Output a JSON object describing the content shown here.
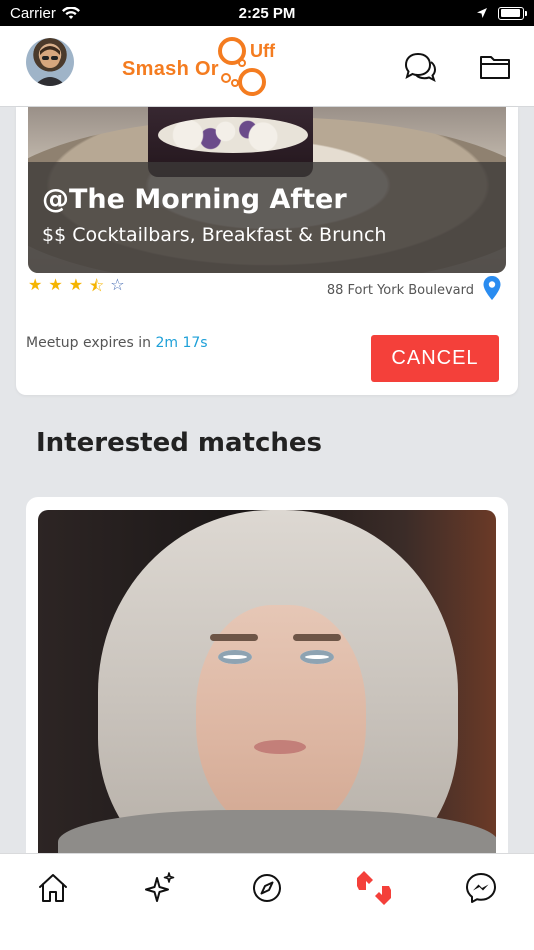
{
  "status_bar": {
    "carrier": "Carrier",
    "time": "2:25 PM",
    "battery_level": 0.9
  },
  "header": {
    "logo": {
      "text": "Smash Or",
      "suffix": "Uff",
      "brand_color": "#f47c20"
    },
    "icons": [
      "avatar",
      "chat-bubbles-icon",
      "folder-icon"
    ]
  },
  "venue": {
    "name": "@The Morning After",
    "category": "$$ Cocktailbars, Breakfast & Brunch",
    "rating": 3.5,
    "rating_max": 5,
    "address": "88 Fort York Boulevard",
    "expiry_prefix": "Meetup expires in ",
    "expiry_time": "2m 17s",
    "cancel_label": "CANCEL",
    "colors": {
      "star": "#f5b400",
      "cancel": "#f4403a",
      "pin": "#2a8cf0",
      "expiry": "#1ea0d8"
    }
  },
  "matches": {
    "title": "Interested matches"
  },
  "tab_bar": {
    "tabs": [
      {
        "icon": "home-icon",
        "active": false
      },
      {
        "icon": "sparkle-icon",
        "active": false
      },
      {
        "icon": "compass-icon",
        "active": false
      },
      {
        "icon": "meetups-icon",
        "active": true
      },
      {
        "icon": "messenger-icon",
        "active": false
      }
    ],
    "active_color": "#f4403a"
  }
}
